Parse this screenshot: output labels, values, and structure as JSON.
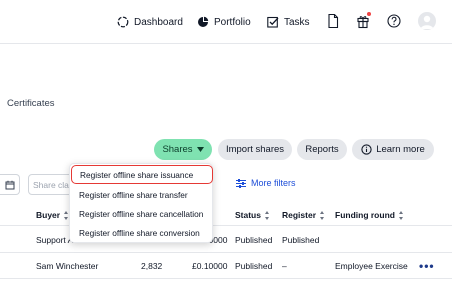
{
  "nav": {
    "dashboard": "Dashboard",
    "portfolio": "Portfolio",
    "tasks": "Tasks",
    "icons": [
      "document-icon",
      "gift-icon",
      "help-icon",
      "avatar"
    ]
  },
  "page": {
    "label": "Certificates"
  },
  "actions": {
    "shares": "Shares",
    "import_shares": "Import shares",
    "reports": "Reports",
    "learn_more": "Learn more"
  },
  "filters": {
    "share_class_placeholder": "Share class",
    "more_filters": "More filters"
  },
  "table": {
    "headers": {
      "buyer": "Buyer",
      "status": "Status",
      "register": "Register",
      "funding_round": "Funding round"
    },
    "rows": [
      {
        "buyer": "Support A",
        "quantity": "",
        "price": "£0.10000",
        "status": "Published",
        "register": "Published",
        "funding_round": ""
      },
      {
        "buyer": "Sam Winchester",
        "quantity": "2,832",
        "price": "£0.10000",
        "status": "Published",
        "register": "–",
        "funding_round": "Employee Exercise"
      }
    ]
  },
  "menu": {
    "items": [
      "Register offline share issuance",
      "Register offline share transfer",
      "Register offline share cancellation",
      "Register offline share conversion"
    ]
  },
  "colors": {
    "accent": "#7fe2b1",
    "link": "#1d4ed8",
    "highlight_border": "#e53935",
    "notification": "#ef4444"
  }
}
